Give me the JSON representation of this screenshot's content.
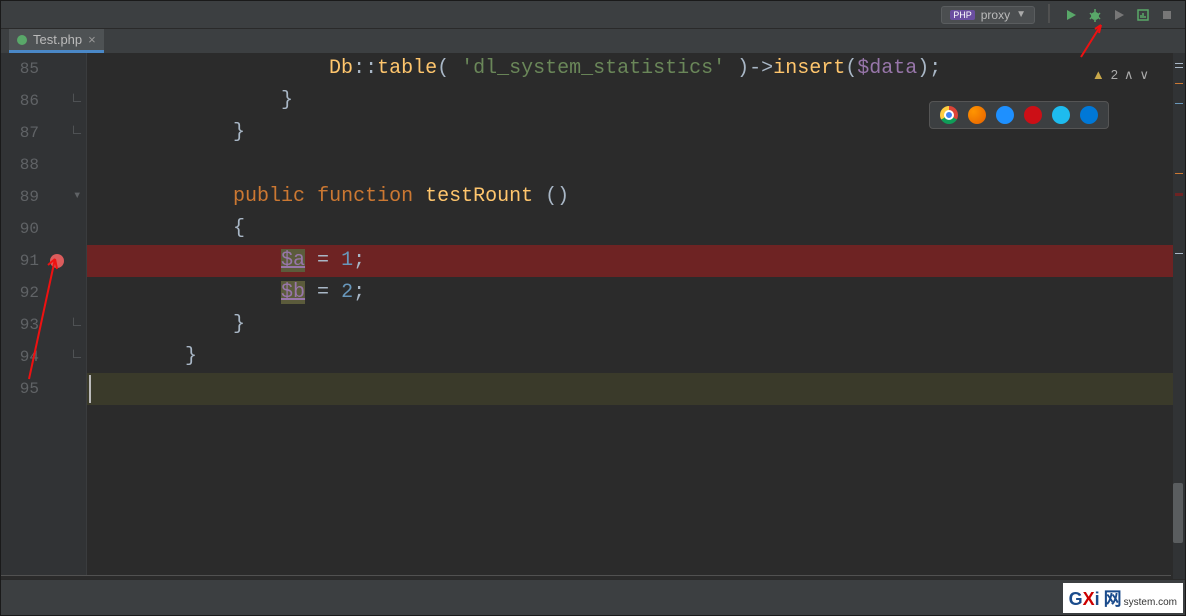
{
  "toolbar": {
    "run_config_type": "PHP",
    "run_config_name": "proxy",
    "icons": [
      "run",
      "debug",
      "coverage",
      "profile",
      "stop"
    ]
  },
  "tab": {
    "filename": "Test.php"
  },
  "inspection": {
    "warning_count": "2"
  },
  "browsers": [
    "chrome",
    "firefox",
    "safari",
    "opera",
    "ie",
    "edge"
  ],
  "code": {
    "lines": [
      {
        "n": "85",
        "tokens": [
          {
            "t": "                    ",
            "c": "punc"
          },
          {
            "t": "Db",
            "c": "static"
          },
          {
            "t": "::",
            "c": "op"
          },
          {
            "t": "table",
            "c": "fn"
          },
          {
            "t": "( ",
            "c": "paren"
          },
          {
            "t": "'dl_system_statistics'",
            "c": "str"
          },
          {
            "t": " )",
            "c": "paren"
          },
          {
            "t": "->",
            "c": "arrow"
          },
          {
            "t": "insert",
            "c": "fn"
          },
          {
            "t": "(",
            "c": "paren"
          },
          {
            "t": "$data",
            "c": "var"
          },
          {
            "t": ");",
            "c": "punc"
          }
        ]
      },
      {
        "n": "86",
        "tokens": [
          {
            "t": "                }",
            "c": "punc"
          }
        ],
        "fold": "close"
      },
      {
        "n": "87",
        "tokens": [
          {
            "t": "            }",
            "c": "punc"
          }
        ],
        "fold": "close"
      },
      {
        "n": "88",
        "tokens": []
      },
      {
        "n": "89",
        "tokens": [
          {
            "t": "            ",
            "c": "punc"
          },
          {
            "t": "public",
            "c": "kw"
          },
          {
            "t": " ",
            "c": "punc"
          },
          {
            "t": "function",
            "c": "kw"
          },
          {
            "t": " ",
            "c": "punc"
          },
          {
            "t": "testRount",
            "c": "fn"
          },
          {
            "t": " ()",
            "c": "paren"
          }
        ],
        "fold": "open"
      },
      {
        "n": "90",
        "tokens": [
          {
            "t": "            {",
            "c": "punc"
          }
        ]
      },
      {
        "n": "91",
        "tokens": [
          {
            "t": "                ",
            "c": "punc"
          },
          {
            "t": "$a",
            "c": "varhl"
          },
          {
            "t": " = ",
            "c": "op"
          },
          {
            "t": "1",
            "c": "num"
          },
          {
            "t": ";",
            "c": "punc"
          }
        ],
        "bp": true,
        "hl": "bp"
      },
      {
        "n": "92",
        "tokens": [
          {
            "t": "                ",
            "c": "punc"
          },
          {
            "t": "$b",
            "c": "varhl"
          },
          {
            "t": " = ",
            "c": "op"
          },
          {
            "t": "2",
            "c": "num"
          },
          {
            "t": ";",
            "c": "punc"
          }
        ]
      },
      {
        "n": "93",
        "tokens": [
          {
            "t": "            }",
            "c": "punc"
          }
        ],
        "fold": "close"
      },
      {
        "n": "94",
        "tokens": [
          {
            "t": "        }",
            "c": "punc"
          }
        ],
        "fold": "close"
      },
      {
        "n": "95",
        "tokens": [],
        "hl": "caret",
        "caret": true
      }
    ]
  },
  "watermark": {
    "g": "G",
    "x": "X",
    "i": "i",
    "net": "网",
    "domain": "system.com"
  }
}
